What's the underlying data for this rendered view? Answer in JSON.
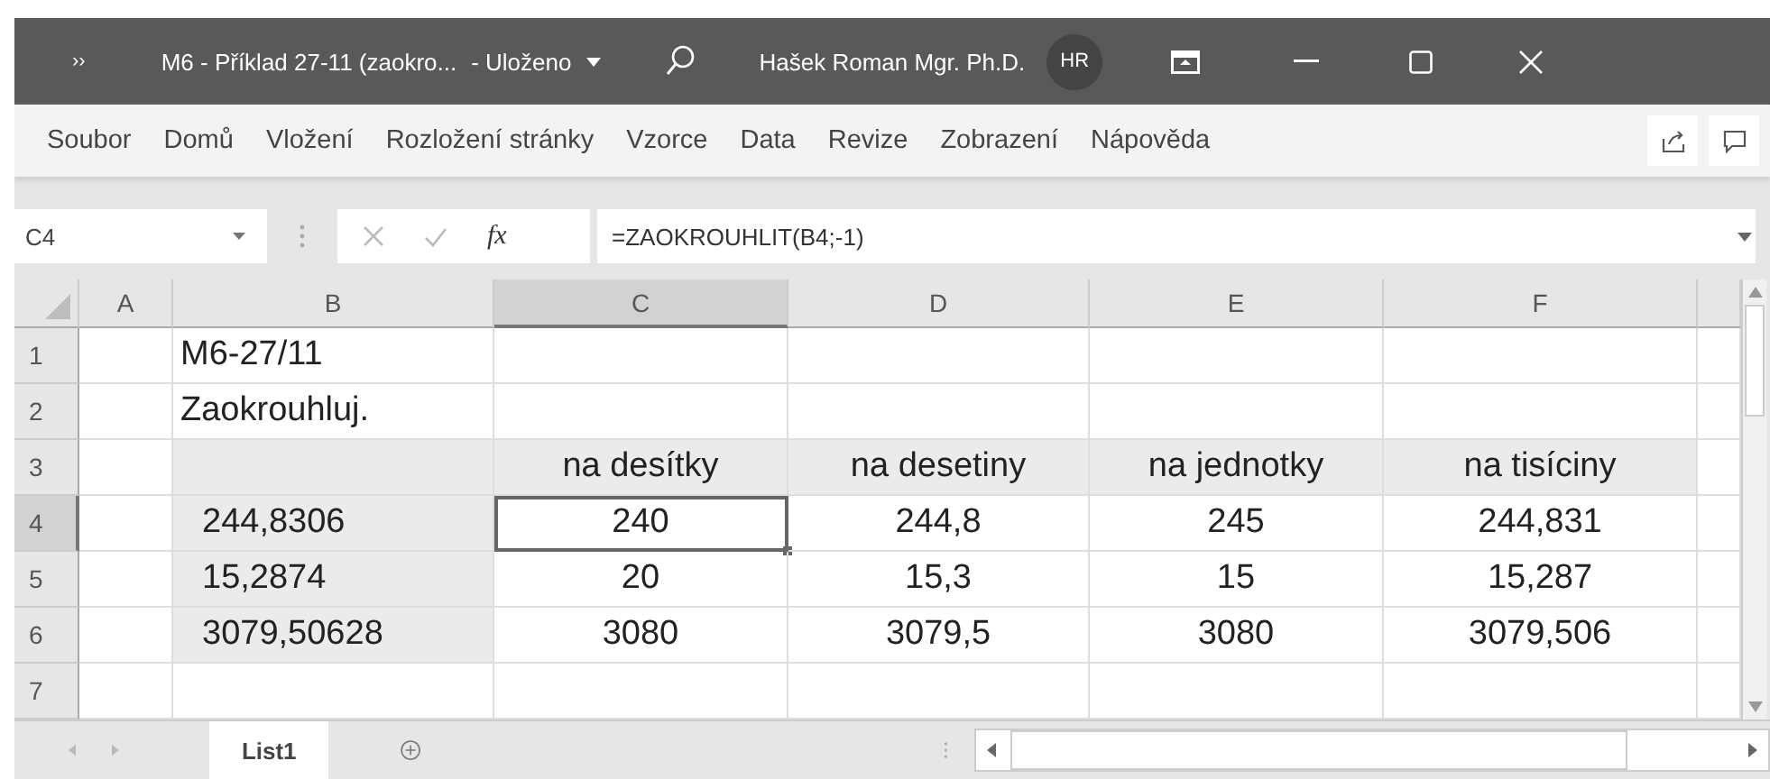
{
  "title_bar": {
    "quick_access": "››",
    "title": "M6 - Příklad 27-11 (zaokro...",
    "status": "- Uloženo",
    "user": "Hašek Roman Mgr. Ph.D.",
    "avatar": "HR"
  },
  "ribbon_tabs": [
    "Soubor",
    "Domů",
    "Vložení",
    "Rozložení stránky",
    "Vzorce",
    "Data",
    "Revize",
    "Zobrazení",
    "Nápověda"
  ],
  "formula_bar": {
    "name_box": "C4",
    "function_label": "fx",
    "formula": "=ZAOKROUHLIT(B4;-1)"
  },
  "columns": [
    {
      "label": "A",
      "selected": false
    },
    {
      "label": "B",
      "selected": false
    },
    {
      "label": "C",
      "selected": true
    },
    {
      "label": "D",
      "selected": false
    },
    {
      "label": "E",
      "selected": false
    },
    {
      "label": "F",
      "selected": false
    }
  ],
  "rows": [
    {
      "header": "1",
      "selected": false,
      "cells": [
        null,
        {
          "text": "M6-27/11",
          "indented": false,
          "shaded": false,
          "selected": false
        },
        null,
        null,
        null,
        null
      ]
    },
    {
      "header": "2",
      "selected": false,
      "cells": [
        null,
        {
          "text": "Zaokrouhluj.",
          "indented": false,
          "shaded": false,
          "selected": false
        },
        null,
        null,
        null,
        null
      ]
    },
    {
      "header": "3",
      "selected": false,
      "cells": [
        null,
        {
          "shaded": true
        },
        {
          "text": "na desítky",
          "shaded": true,
          "selected": false
        },
        {
          "text": "na desetiny",
          "shaded": true,
          "selected": false
        },
        {
          "text": "na jednotky",
          "shaded": true,
          "selected": false
        },
        {
          "text": "na tisíciny",
          "shaded": true,
          "selected": false
        }
      ]
    },
    {
      "header": "4",
      "selected": true,
      "cells": [
        null,
        {
          "text": "244,8306",
          "indented": true,
          "shaded": true,
          "selected": false
        },
        {
          "text": "240",
          "shaded": false,
          "selected": true
        },
        {
          "text": "244,8",
          "shaded": false,
          "selected": false
        },
        {
          "text": "245",
          "shaded": false,
          "selected": false
        },
        {
          "text": "244,831",
          "shaded": false,
          "selected": false
        }
      ]
    },
    {
      "header": "5",
      "selected": false,
      "cells": [
        null,
        {
          "text": "15,2874",
          "indented": true,
          "shaded": true,
          "selected": false
        },
        {
          "text": "20",
          "shaded": false,
          "selected": false
        },
        {
          "text": "15,3",
          "shaded": false,
          "selected": false
        },
        {
          "text": "15",
          "shaded": false,
          "selected": false
        },
        {
          "text": "15,287",
          "shaded": false,
          "selected": false
        }
      ]
    },
    {
      "header": "6",
      "selected": false,
      "cells": [
        null,
        {
          "text": "3079,50628",
          "indented": true,
          "shaded": true,
          "selected": false
        },
        {
          "text": "3080",
          "shaded": false,
          "selected": false
        },
        {
          "text": "3079,5",
          "shaded": false,
          "selected": false
        },
        {
          "text": "3080",
          "shaded": false,
          "selected": false
        },
        {
          "text": "3079,506",
          "shaded": false,
          "selected": false
        }
      ]
    },
    {
      "header": "7",
      "selected": false,
      "cells": [
        null,
        null,
        null,
        null,
        null,
        null
      ]
    }
  ],
  "sheet_tabs": [
    {
      "label": "List1",
      "selected": true
    }
  ]
}
